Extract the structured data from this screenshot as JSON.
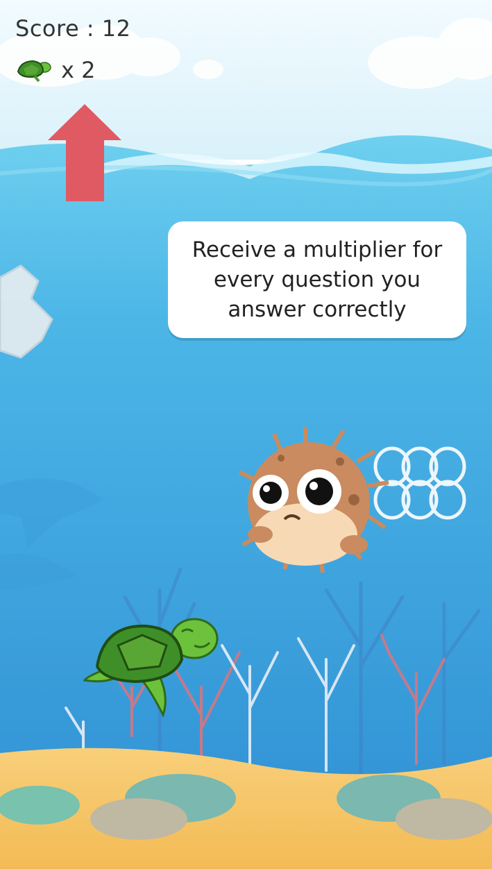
{
  "hud": {
    "score_label": "Score : 12",
    "lives_label": "x 2",
    "lives_icon": "turtle-icon"
  },
  "tooltip": {
    "text": "Receive a multiplier for every question you answer correctly"
  },
  "colors": {
    "sky": "#e8f6fb",
    "sea_top": "#5cc6ea",
    "sea_bottom": "#2f8fd3",
    "sand": "#f6c56a",
    "arrow": "#e05a63",
    "turtle": "#4c9a2a",
    "pufferfish": "#c98b5f"
  }
}
